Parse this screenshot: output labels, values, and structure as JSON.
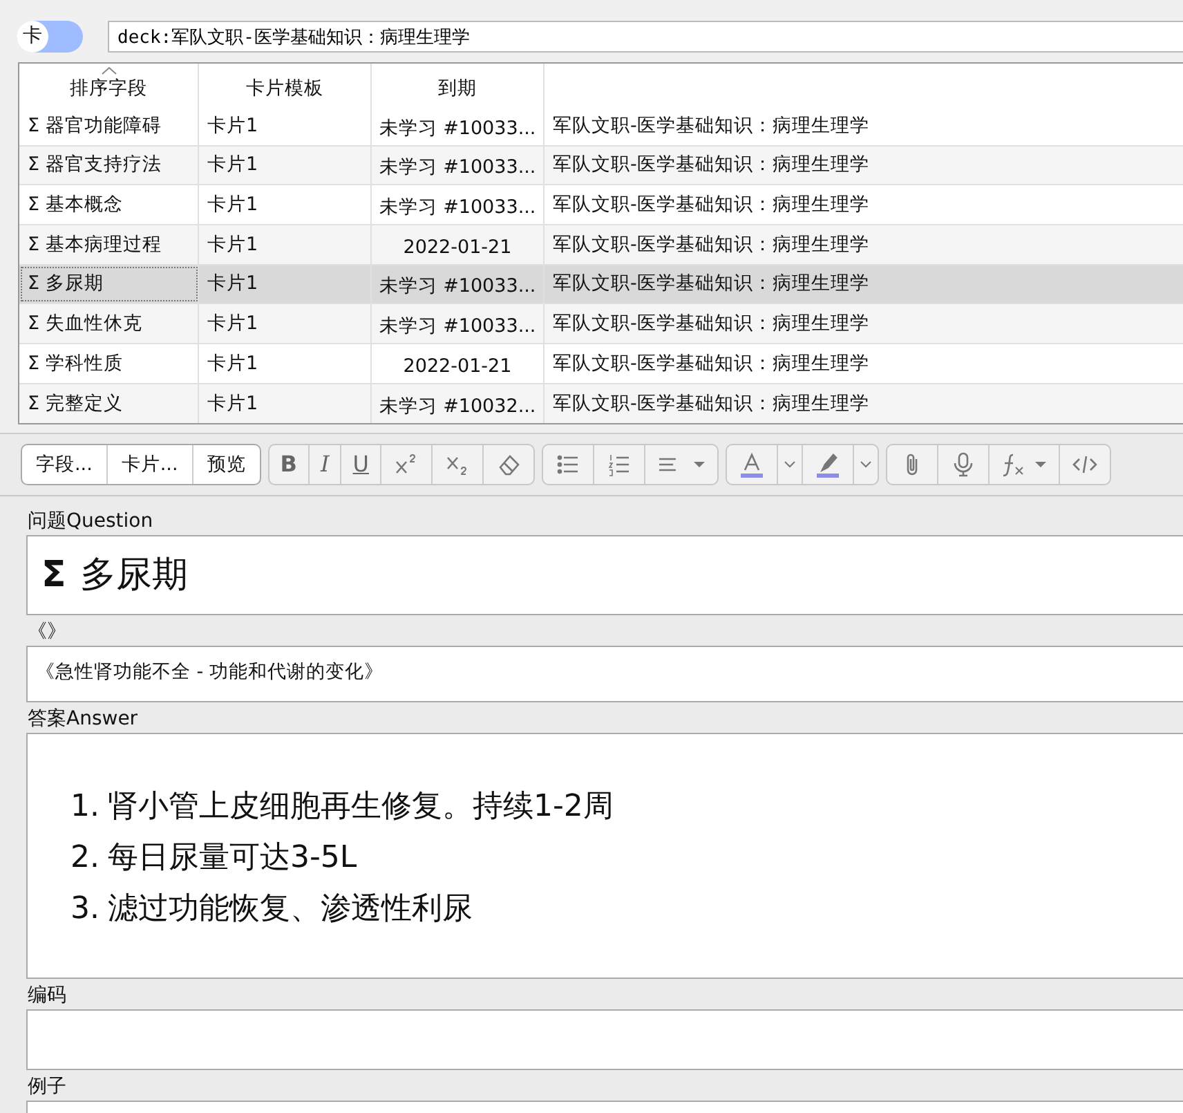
{
  "toggle": {
    "label": "卡",
    "on": false
  },
  "search": {
    "value": "deck:军队文职-医学基础知识：病理生理学"
  },
  "table": {
    "columns": [
      "排序字段",
      "卡片模板",
      "到期"
    ],
    "rows": [
      {
        "sort_field": "Σ 器官功能障碍",
        "template": "卡片1",
        "due": "未学习 #10033...",
        "deck": "军队文职-医学基础知识：病理生理学",
        "selected": false
      },
      {
        "sort_field": "Σ 器官支持疗法",
        "template": "卡片1",
        "due": "未学习 #10033...",
        "deck": "军队文职-医学基础知识：病理生理学",
        "selected": false
      },
      {
        "sort_field": "Σ 基本概念",
        "template": "卡片1",
        "due": "未学习 #10033...",
        "deck": "军队文职-医学基础知识：病理生理学",
        "selected": false
      },
      {
        "sort_field": "Σ 基本病理过程",
        "template": "卡片1",
        "due": "2022-01-21",
        "deck": "军队文职-医学基础知识：病理生理学",
        "selected": false
      },
      {
        "sort_field": "Σ 多尿期",
        "template": "卡片1",
        "due": "未学习 #10033...",
        "deck": "军队文职-医学基础知识：病理生理学",
        "selected": true
      },
      {
        "sort_field": "Σ 失血性休克",
        "template": "卡片1",
        "due": "未学习 #10033...",
        "deck": "军队文职-医学基础知识：病理生理学",
        "selected": false
      },
      {
        "sort_field": "Σ 学科性质",
        "template": "卡片1",
        "due": "2022-01-21",
        "deck": "军队文职-医学基础知识：病理生理学",
        "selected": false
      },
      {
        "sort_field": "Σ 完整定义",
        "template": "卡片1",
        "due": "未学习 #10032...",
        "deck": "军队文职-医学基础知识：病理生理学",
        "selected": false
      }
    ]
  },
  "toolbar": {
    "tabs": [
      "字段...",
      "卡片...",
      "预览"
    ],
    "format_buttons": [
      "B",
      "I",
      "U"
    ]
  },
  "fields": [
    {
      "label": "问题Question",
      "kind": "title",
      "symbol": "Σ",
      "text": "多尿期"
    },
    {
      "label": "《》",
      "kind": "text",
      "text": "《急性肾功能不全 - 功能和代谢的变化》"
    },
    {
      "label": "答案Answer",
      "kind": "list",
      "items": [
        {
          "marker": "1.",
          "text": "肾小管上皮细胞再生修复。持续1-2周"
        },
        {
          "marker": "2.",
          "text": "每日尿量可达3-5L"
        },
        {
          "marker": "3.",
          "text": "滤过功能恢复、渗透性利尿"
        }
      ]
    },
    {
      "label": "编码",
      "kind": "empty"
    },
    {
      "label": "例子",
      "kind": "empty"
    }
  ]
}
